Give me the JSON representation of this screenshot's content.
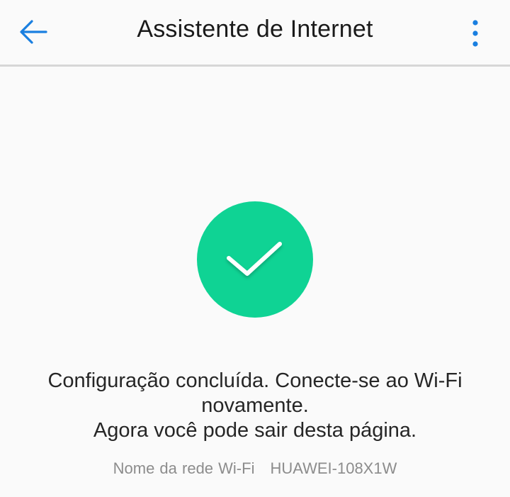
{
  "header": {
    "title": "Assistente de Internet",
    "back_icon": "arrow-left-icon",
    "menu_icon": "more-vertical-icon"
  },
  "status": {
    "icon": "check-icon",
    "message_line1": "Configuração concluída. Conecte-se ao Wi-Fi",
    "message_line2": "novamente.",
    "message_line3": "Agora você pode sair desta página.",
    "network_label": "Nome da rede Wi-Fi",
    "network_name": "HUAWEI-108X1W"
  },
  "colors": {
    "accent": "#1a7fe0",
    "success": "#0fd394"
  }
}
